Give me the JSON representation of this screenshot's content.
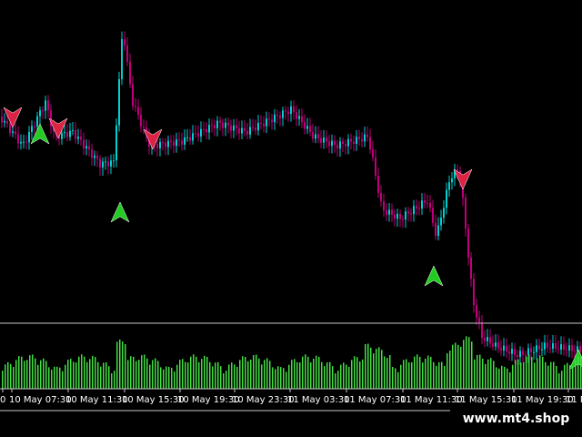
{
  "chart": {
    "background": "#000000",
    "candle_up_color": "#00d0d0",
    "candle_down_color": "#c0007a",
    "volume_color": "#44dd44",
    "buy_arrow_color": "#22cc22",
    "sell_arrow_color": "#dd2244",
    "separator_color": "#c8c8c8",
    "time_axis_labels": [
      "0",
      "10 May 07:30",
      "10 May 11:30",
      "10 May 15:30",
      "10 May 19:30",
      "10 May 23:30",
      "11 May 03:30",
      "11 May 07:30",
      "11 May 11:30",
      "11 May 15:30",
      "11 May 19:30",
      "11 M"
    ],
    "watermark": "www.mt4.shop"
  }
}
